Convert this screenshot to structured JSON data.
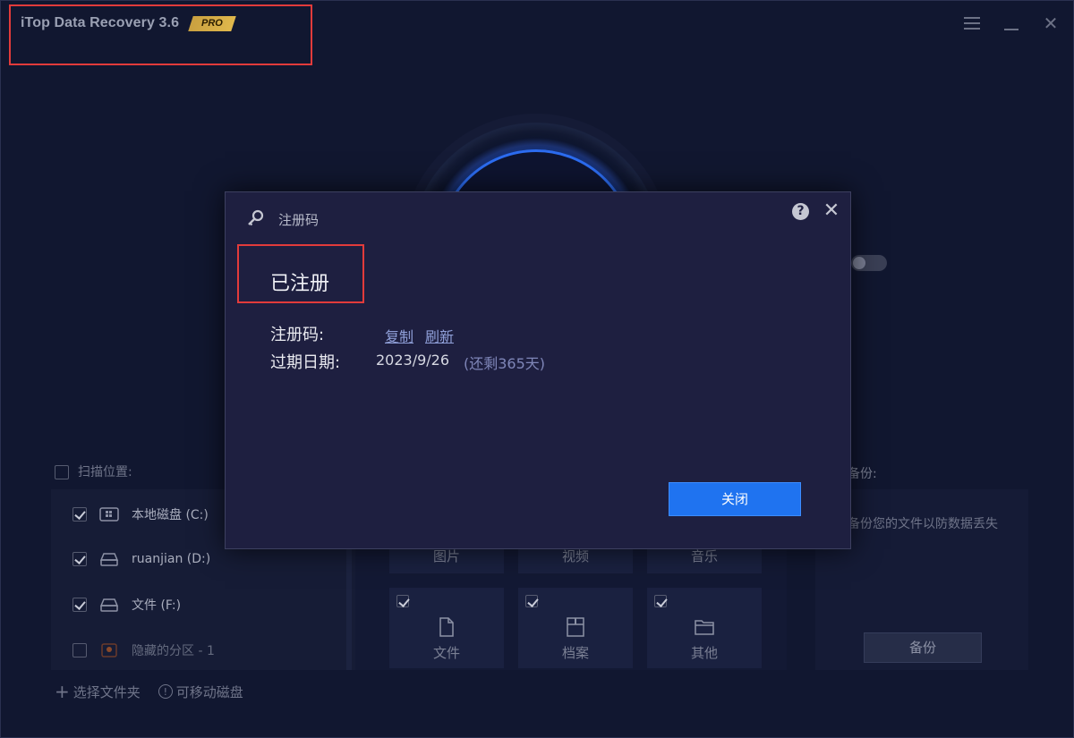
{
  "app": {
    "title": "iTop Data Recovery 3.6",
    "badge": "PRO"
  },
  "scan": {
    "location_label": "扫描位置:",
    "drives": [
      {
        "label": "本地磁盘 (C:)",
        "checked": true
      },
      {
        "label": "ruanjian (D:)",
        "checked": true
      },
      {
        "label": "文件 (F:)",
        "checked": true
      },
      {
        "label": "隐藏的分区 - 1",
        "checked": false
      }
    ],
    "add_folder": "选择文件夹",
    "removable": "可移动磁盘"
  },
  "types": {
    "row1": [
      "图片",
      "视频",
      "音乐"
    ],
    "row2": [
      "文件",
      "档案",
      "其他"
    ]
  },
  "backup": {
    "title": "备份:",
    "description": "备份您的文件以防数据丢失",
    "button": "备份"
  },
  "dialog": {
    "title": "注册码",
    "help": "?",
    "status": "已注册",
    "code_label": "注册码:",
    "copy_link": "复制",
    "refresh_link": "刷新",
    "expiry_label": "过期日期:",
    "expiry_date": "2023/9/26",
    "remaining": "(还剩365天)",
    "close_button": "关闭"
  },
  "colors": {
    "accent": "#1f73f0",
    "highlight": "#e23b3b",
    "badge": "#d4ab45"
  }
}
